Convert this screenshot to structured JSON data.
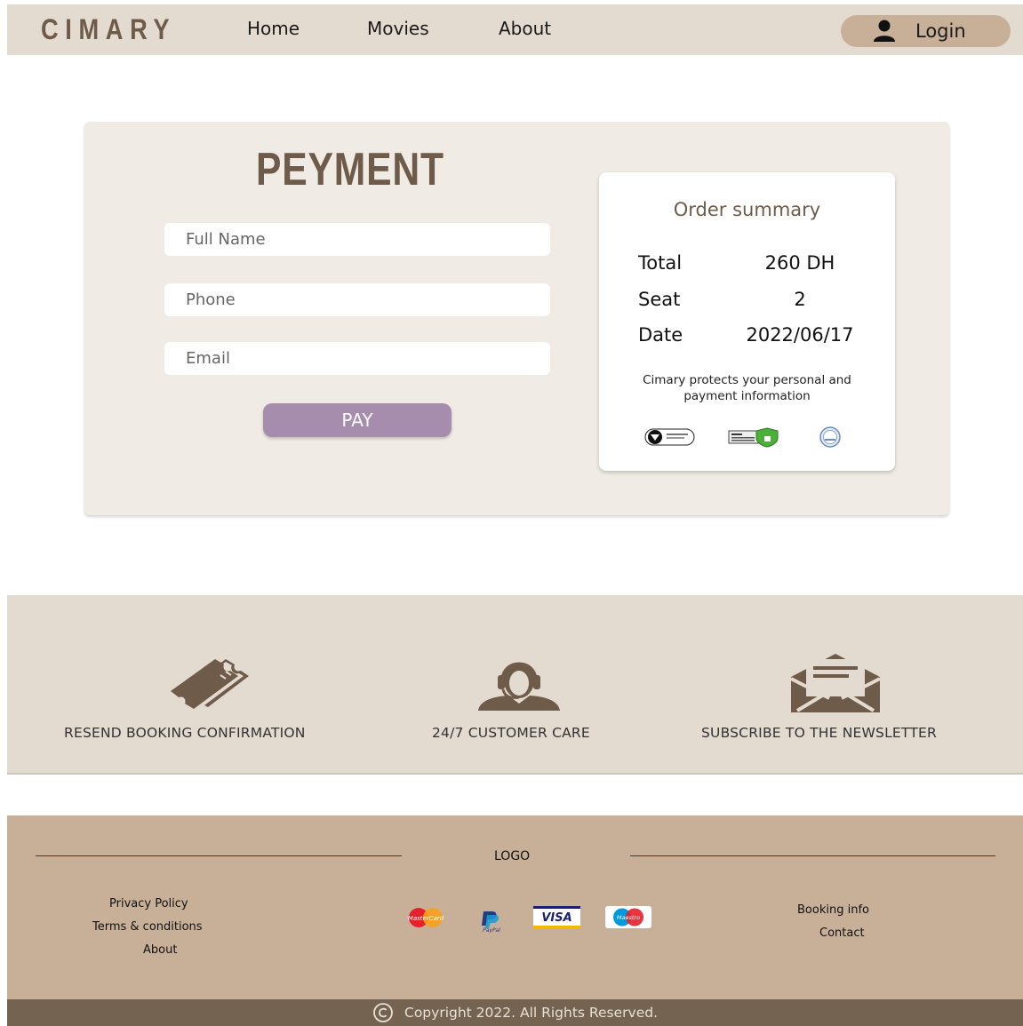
{
  "navbar": {
    "brand": "CIMARY",
    "links": [
      {
        "label": "Home"
      },
      {
        "label": "Movies"
      },
      {
        "label": "About"
      }
    ],
    "login_label": "Login",
    "login_icon": "user-icon"
  },
  "payment": {
    "title": "PEYMENT",
    "fields": [
      {
        "placeholder": "Full Name",
        "value": ""
      },
      {
        "placeholder": "Phone",
        "value": ""
      },
      {
        "placeholder": "Email",
        "value": ""
      }
    ],
    "pay_label": "PAY"
  },
  "summary": {
    "title": "Order summary",
    "rows": [
      {
        "label": "Total",
        "value": "260 DH"
      },
      {
        "label": "Seat",
        "value": "2"
      },
      {
        "label": "Date",
        "value": "2022/06/17"
      }
    ],
    "note": "Cimary protects your personal and payment information",
    "badges": [
      "secure-badge-icon",
      "ssl-secure-connection-icon",
      "certified-seal-icon"
    ]
  },
  "services": [
    {
      "label": "RESEND BOOKING CONFIRMATION",
      "icon": "tickets-icon"
    },
    {
      "label": "24/7 CUSTOMER CARE",
      "icon": "headset-agent-icon"
    },
    {
      "label": "SUBSCRIBE TO THE NEWSLETTER",
      "icon": "open-envelope-icon"
    }
  ],
  "footer": {
    "logo": "LOGO",
    "left_links": [
      "Privacy Policy",
      "Terms & conditions",
      "About"
    ],
    "right_links": [
      "Booking info",
      "Contact"
    ],
    "payment_icons": [
      "mastercard-icon",
      "paypal-icon",
      "visa-icon",
      "maestro-icon"
    ],
    "copyright": "Copyright 2022.  All Rights Reserved."
  },
  "colors": {
    "brand": "#6f5b49",
    "nav_bg": "#e3dbd0",
    "card_bg": "#f0ebe4",
    "pay_button": "#a68dae",
    "footer_bg": "#c8b098",
    "copyright_bg": "#746350"
  }
}
